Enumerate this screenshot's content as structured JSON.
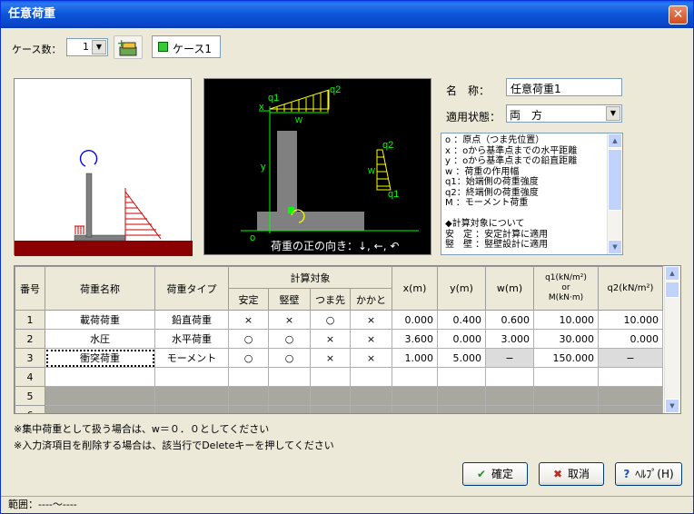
{
  "window": {
    "title": "任意荷重",
    "close_label": "✕"
  },
  "toolbar": {
    "case_count_label": "ケース数：",
    "case_count_value": "1",
    "case_tab_label": "ケース1"
  },
  "diagram": {
    "label_q1": "q1",
    "label_q2": "q2",
    "label_x": "x",
    "label_w": "w",
    "label_y": "y",
    "label_o": "o",
    "label_q1b": "q1",
    "label_q2b": "q2",
    "label_wb": "w",
    "caption": "荷重の正の向き：↓, ←, ↶"
  },
  "form": {
    "name_label": "名　称：",
    "name_value": "任意荷重1",
    "state_label": "適用状態：",
    "state_value": "両　方"
  },
  "description": {
    "lines": [
      "o ：原点（つま先位置）",
      "x ：oから基準点までの水平距離",
      "y ：oから基準点までの鉛直距離",
      "w ：荷重の作用幅",
      "q1：始端側の荷重強度",
      "q2：終端側の荷重強度",
      "M ：モーメント荷重",
      "",
      "◆計算対象について",
      "安　定 ：安定計算に適用",
      "竪　壁 ：竪壁設計に適用"
    ]
  },
  "table": {
    "headers": {
      "no": "番号",
      "name": "荷重名称",
      "type": "荷重タイプ",
      "target": "計算対象",
      "stab": "安定",
      "wall": "竪壁",
      "toe": "つま先",
      "heel": "かかと",
      "x": "x(m)",
      "y": "y(m)",
      "w": "w(m)",
      "q1_l1": "q1(kN/m²)",
      "q1_l2": "or",
      "q1_l3": "M(kN·m)",
      "q2": "q2(kN/m²)"
    },
    "rows": [
      {
        "no": "1",
        "name": "載荷荷重",
        "type": "鉛直荷重",
        "stab": "×",
        "wall": "×",
        "toe": "○",
        "heel": "×",
        "x": "0.000",
        "y": "0.400",
        "w": "0.600",
        "q1": "10.000",
        "q2": "10.000"
      },
      {
        "no": "2",
        "name": "水圧",
        "type": "水平荷重",
        "stab": "○",
        "wall": "○",
        "toe": "×",
        "heel": "×",
        "x": "3.600",
        "y": "0.000",
        "w": "3.000",
        "q1": "30.000",
        "q2": "0.000"
      },
      {
        "no": "3",
        "name": "衝突荷重",
        "type": "モーメント",
        "stab": "○",
        "wall": "○",
        "toe": "×",
        "heel": "×",
        "x": "1.000",
        "y": "5.000",
        "w": "−",
        "q1": "150.000",
        "q2": "−"
      },
      {
        "no": "4"
      },
      {
        "no": "5"
      },
      {
        "no": "6"
      }
    ]
  },
  "notes": [
    "※集中荷重として扱う場合は、w＝０．０としてください",
    "※入力済項目を削除する場合は、該当行でDeleteキーを押してください"
  ],
  "buttons": {
    "ok": "確定",
    "cancel": "取消",
    "help": "ﾍﾙﾌﾟ(H)"
  },
  "status": {
    "text": "範囲：----～----"
  },
  "colors": {
    "ground": "#8b0000",
    "wall": "#808080",
    "load": "#ffff00",
    "dim": "#00ff00",
    "water": "#ff0000"
  }
}
